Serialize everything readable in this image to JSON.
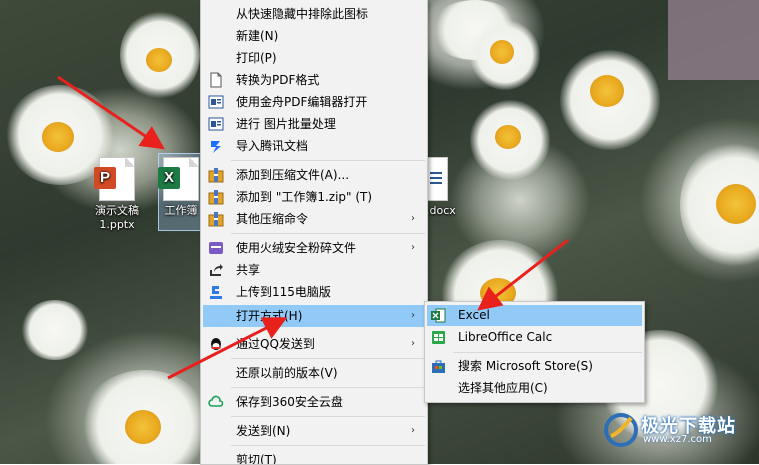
{
  "desktop": {
    "icons": [
      {
        "label_line1": "演示文稿",
        "label_line2": "1.pptx",
        "badge": "P",
        "type": "pptx"
      },
      {
        "label_line1": "工作簿",
        "badge": "X",
        "type": "xlsx"
      },
      {
        "label_line1": ".docx",
        "type": "docx"
      }
    ]
  },
  "context_menu": {
    "items": [
      {
        "label": "从快速隐藏中排除此图标"
      },
      {
        "label": "新建(N)"
      },
      {
        "label": "打印(P)"
      },
      {
        "label": "转换为PDF格式",
        "icon": "pdf-page-icon"
      },
      {
        "label": "使用金舟PDF编辑器打开",
        "icon": "pdf-editor-icon"
      },
      {
        "label": "进行 图片批量处理",
        "icon": "image-batch-icon"
      },
      {
        "label": "导入腾讯文档",
        "icon": "tencent-docs-icon"
      },
      {
        "label": "添加到压缩文件(A)...",
        "icon": "archive-icon"
      },
      {
        "label": "添加到 \"工作簿1.zip\" (T)",
        "icon": "archive-icon"
      },
      {
        "label": "其他压缩命令",
        "icon": "archive-icon",
        "submenu": true
      },
      {
        "label": "使用火绒安全粉碎文件",
        "icon": "shredder-icon",
        "submenu": true
      },
      {
        "label": "共享",
        "icon": "share-icon"
      },
      {
        "label": "上传到115电脑版",
        "icon": "upload-115-icon"
      },
      {
        "label": "打开方式(H)",
        "submenu": true,
        "highlighted": true
      },
      {
        "label": "通过QQ发送到",
        "icon": "qq-icon",
        "submenu": true
      },
      {
        "label": "还原以前的版本(V)"
      },
      {
        "label": "保存到360安全云盘",
        "icon": "cloud-360-icon"
      },
      {
        "label": "发送到(N)",
        "submenu": true
      },
      {
        "label": "剪切(T)"
      }
    ],
    "submenu_arrow": "›"
  },
  "open_with_submenu": {
    "items": [
      {
        "label": "Excel",
        "icon": "excel-icon",
        "highlighted": true
      },
      {
        "label": "LibreOffice Calc",
        "icon": "libreoffice-calc-icon"
      },
      {
        "label": "搜索 Microsoft Store(S)",
        "icon": "microsoft-store-icon"
      },
      {
        "label": "选择其他应用(C)"
      }
    ]
  },
  "watermark": {
    "text": "极光下载站",
    "url": "www.xz7.com"
  },
  "colors": {
    "menu_bg": "#f2f2f2",
    "highlight": "#91c9f7",
    "annotation_arrow": "#e8211d",
    "excel_green": "#1d7a44",
    "ppt_orange": "#d04a25"
  }
}
